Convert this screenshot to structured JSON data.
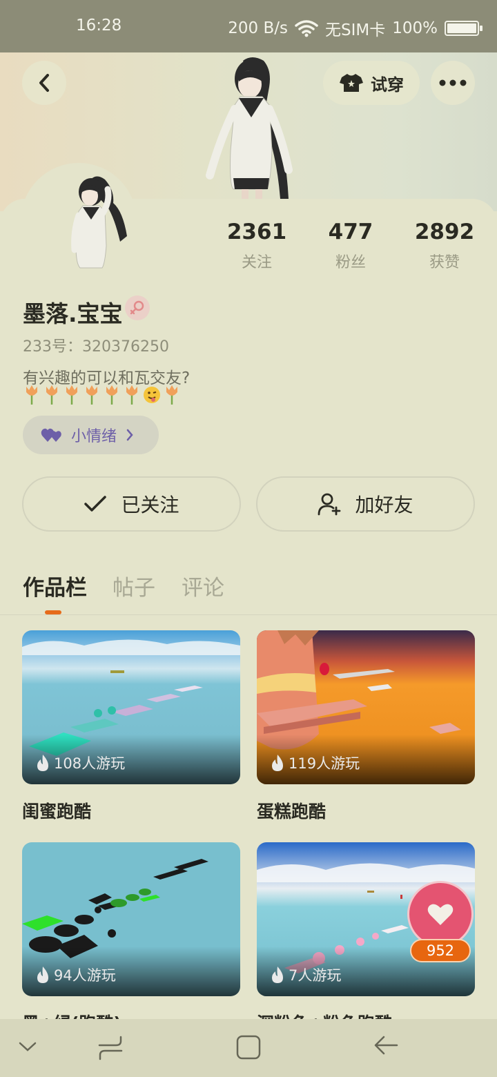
{
  "status_bar": {
    "time": "16:28",
    "network_speed": "200 B/s",
    "sim": "无SIM卡",
    "battery": "100%"
  },
  "header": {
    "try_on_label": "试穿"
  },
  "stats": [
    {
      "value": "2361",
      "label": "关注"
    },
    {
      "value": "477",
      "label": "粉丝"
    },
    {
      "value": "2892",
      "label": "获赞"
    }
  ],
  "profile": {
    "name": "墨落.宝宝",
    "uid": "233号：320376250",
    "bio": "有兴趣的可以和瓦交友?",
    "mood": "小情绪"
  },
  "actions": {
    "followed_label": "已关注",
    "add_friend_label": "加好友"
  },
  "tabs": [
    "作品栏",
    "帖子",
    "评论"
  ],
  "works": [
    {
      "title": "闺蜜跑酷",
      "plays": "108人游玩"
    },
    {
      "title": "蛋糕跑酷",
      "plays": "119人游玩"
    },
    {
      "title": "黑+绿(跑酷)",
      "plays": "94人游玩"
    },
    {
      "title": "深粉色+粉色跑酷",
      "plays": "7人游玩"
    }
  ],
  "like_count": "952",
  "colors": {
    "accent": "#e66b1a",
    "like": "#e45471",
    "mood_text": "#6d5fa8"
  }
}
